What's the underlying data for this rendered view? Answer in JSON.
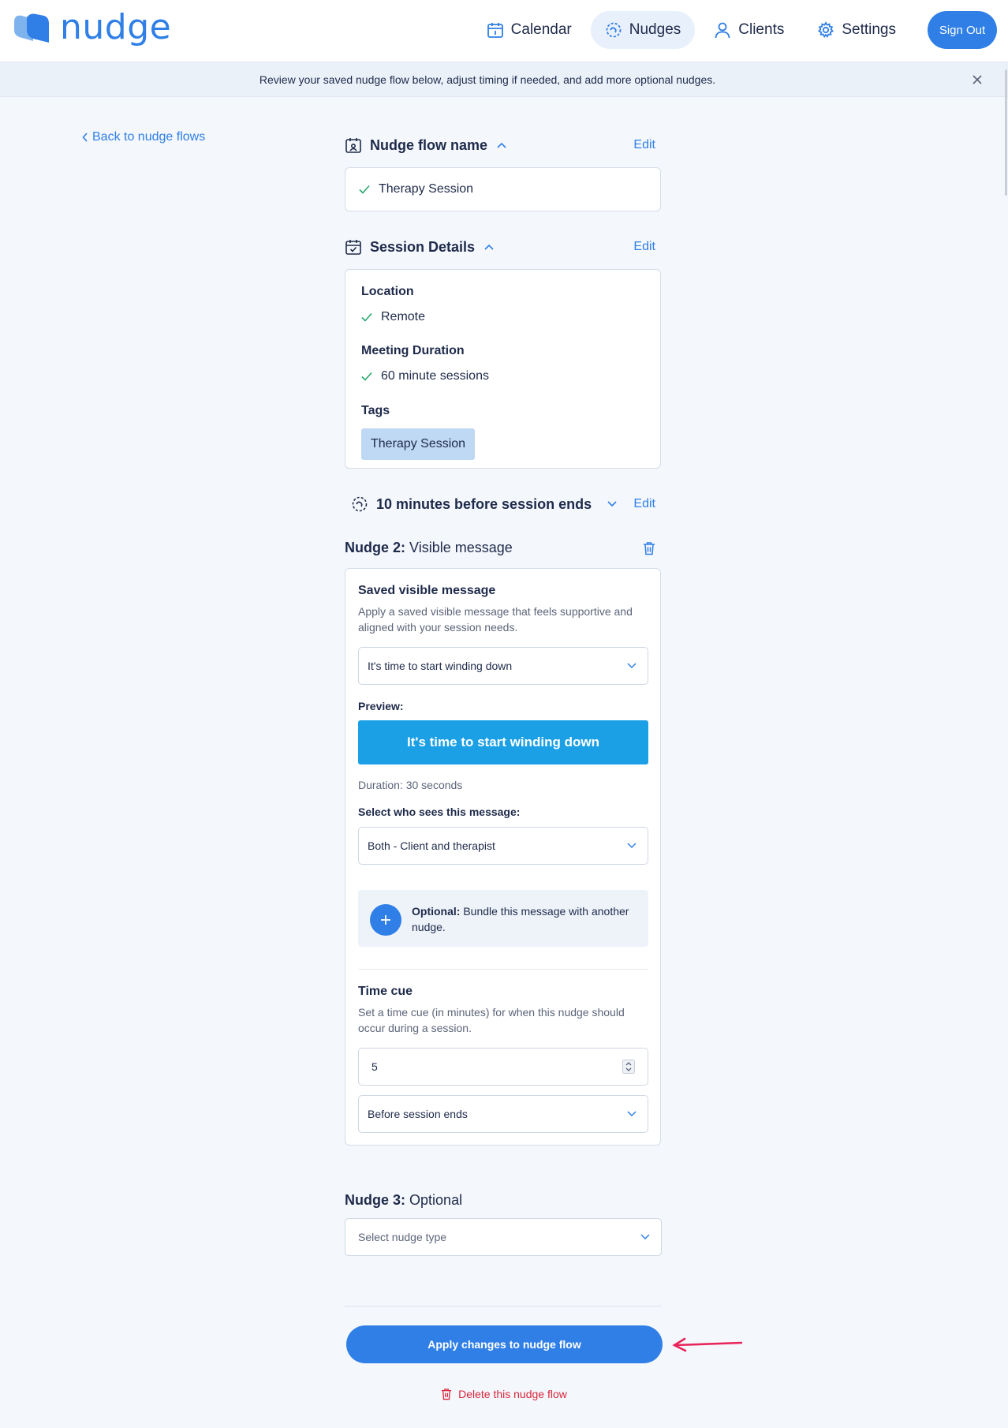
{
  "app": {
    "name": "nudge"
  },
  "nav": {
    "items": [
      {
        "label": "Calendar",
        "icon": "calendar-icon"
      },
      {
        "label": "Nudges",
        "icon": "nudges-icon",
        "active": true
      },
      {
        "label": "Clients",
        "icon": "user-icon"
      },
      {
        "label": "Settings",
        "icon": "gear-icon"
      }
    ],
    "sign_out": "Sign Out"
  },
  "banner": {
    "text": "Review your saved nudge flow below, adjust timing if needed, and add more optional nudges."
  },
  "back_link": "Back to nudge flows",
  "flow_name": {
    "title": "Nudge flow name",
    "edit": "Edit",
    "value": "Therapy Session"
  },
  "session_details": {
    "title": "Session Details",
    "edit": "Edit",
    "location_label": "Location",
    "location_value": "Remote",
    "duration_label": "Meeting Duration",
    "duration_value": "60 minute sessions",
    "tags_label": "Tags",
    "tag": "Therapy Session"
  },
  "timing": {
    "title": "10 minutes before session ends",
    "edit": "Edit"
  },
  "nudge2": {
    "number": "Nudge 2:",
    "type": "Visible message",
    "saved_title": "Saved visible message",
    "saved_desc": "Apply a saved visible message that feels supportive and aligned with your session needs.",
    "message_select": "It's time to start winding down",
    "preview_label": "Preview:",
    "preview_text": "It's time to start winding down",
    "duration": "Duration: 30 seconds",
    "audience_label": "Select who sees this message:",
    "audience_select": "Both - Client and therapist",
    "bundle_bold": "Optional:",
    "bundle_text": "Bundle this message with another nudge.",
    "time_cue_title": "Time cue",
    "time_cue_desc": "Set a time cue (in minutes) for when this nudge should occur during a session.",
    "time_cue_value": "5",
    "time_cue_relation": "Before session ends"
  },
  "nudge3": {
    "number": "Nudge 3:",
    "type": "Optional",
    "select_placeholder": "Select nudge type"
  },
  "actions": {
    "apply": "Apply changes to nudge flow",
    "delete": "Delete this nudge flow"
  },
  "colors": {
    "primary": "#2f7fe6",
    "preview": "#1ba0e6",
    "danger": "#d9273c",
    "annotation_arrow": "#e8245a",
    "check": "#27a66b"
  }
}
